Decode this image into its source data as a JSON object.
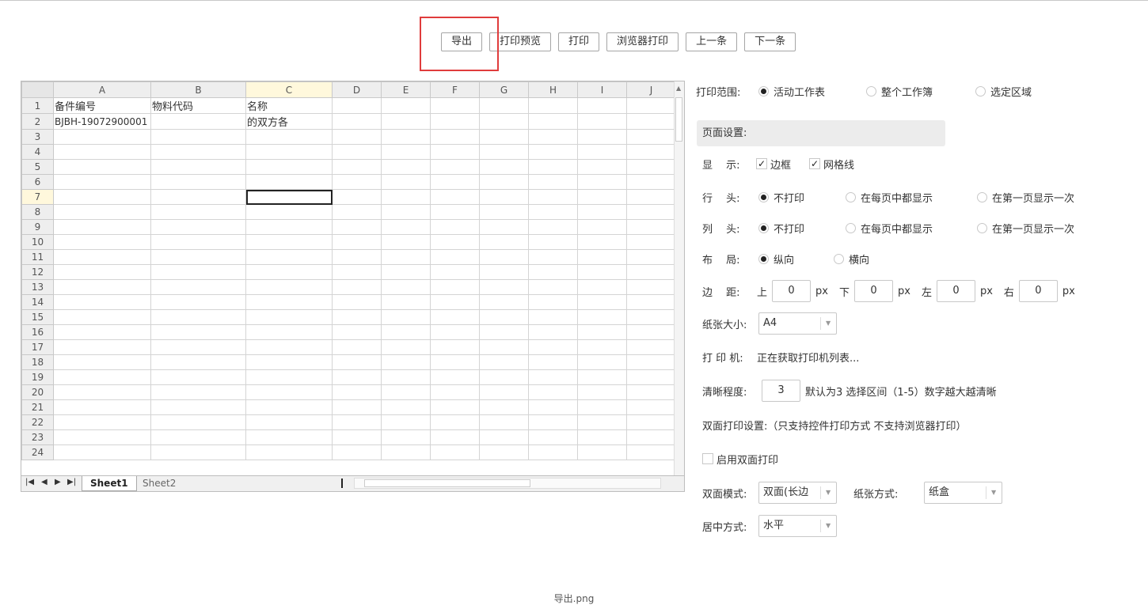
{
  "toolbar": {
    "export": "导出",
    "print_preview": "打印预览",
    "print": "打印",
    "browser_print": "浏览器打印",
    "prev": "上一条",
    "next": "下一条"
  },
  "highlight_color": "#e03c3c",
  "sheet": {
    "columns": [
      "A",
      "B",
      "C",
      "D",
      "E",
      "F",
      "G",
      "H",
      "I",
      "J"
    ],
    "rows": [
      [
        "备件编号",
        "物料代码",
        "名称",
        "",
        "",
        "",
        "",
        "",
        "",
        ""
      ],
      [
        "BJBH-19072900001",
        "",
        "的双方各",
        "",
        "",
        "",
        "",
        "",
        "",
        ""
      ]
    ],
    "row_count": 24,
    "selected_cell": "C7",
    "tabs": [
      "Sheet1",
      "Sheet2"
    ],
    "active_tab": "Sheet1"
  },
  "panel": {
    "print_range": {
      "label": "打印范围:",
      "options": [
        "活动工作表",
        "整个工作簿",
        "选定区域"
      ],
      "selected": "活动工作表"
    },
    "page_setup": "页面设置:",
    "display": {
      "label": "显　 示:",
      "options": [
        "边框",
        "网格线"
      ],
      "checked": [
        true,
        true
      ]
    },
    "row_header": {
      "label": "行　 头:",
      "options": [
        "不打印",
        "在每页中都显示",
        "在第一页显示一次"
      ],
      "selected": "不打印"
    },
    "col_header": {
      "label": "列　 头:",
      "options": [
        "不打印",
        "在每页中都显示",
        "在第一页显示一次"
      ],
      "selected": "不打印"
    },
    "layout": {
      "label": "布　 局:",
      "options": [
        "纵向",
        "横向"
      ],
      "selected": "纵向"
    },
    "margin": {
      "label": "边　 距:",
      "top_label": "上",
      "top": "0",
      "bottom_label": "下",
      "bottom": "0",
      "left_label": "左",
      "left": "0",
      "right_label": "右",
      "right": "0",
      "unit": "px"
    },
    "paper_size": {
      "label": "纸张大小:",
      "value": "A4"
    },
    "printer": {
      "label": "打 印 机:",
      "value": "正在获取打印机列表..."
    },
    "clarity": {
      "label": "清晰程度:",
      "value": "3",
      "hint": "默认为3 选择区间（1-5）数字越大越清晰"
    },
    "duplex_title": "双面打印设置:（只支持控件打印方式 不支持浏览器打印）",
    "duplex_enable": {
      "label": "启用双面打印",
      "checked": false
    },
    "duplex_mode": {
      "label": "双面模式:",
      "value": "双面(长边"
    },
    "paper_source": {
      "label": "纸张方式:",
      "value": "纸盒"
    },
    "center_mode": {
      "label": "居中方式:",
      "value": "水平"
    }
  },
  "caption": "导出.png"
}
